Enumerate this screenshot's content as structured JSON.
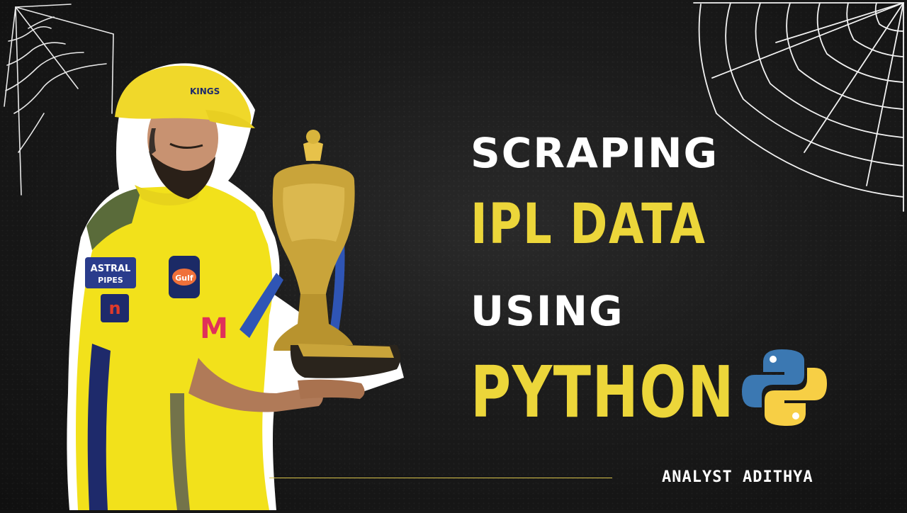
{
  "headline": {
    "line1": "SCRAPING",
    "line2": "IPL DATA",
    "line3": "USING",
    "line4": "PYTHON"
  },
  "author": "ANALYST ADITHYA",
  "icons": {
    "logo": "python-logo-icon",
    "webs": [
      "spider-web-top-left-icon",
      "spider-web-top-right-icon"
    ]
  },
  "colors": {
    "background": "#1b1b1b",
    "headline_white": "#ffffff",
    "headline_yellow": "#ecd63a",
    "python_blue": "#3b78b2",
    "python_yellow": "#f7cf45",
    "jersey_yellow": "#f2e11b",
    "trophy_gold": "#c9a43a"
  }
}
